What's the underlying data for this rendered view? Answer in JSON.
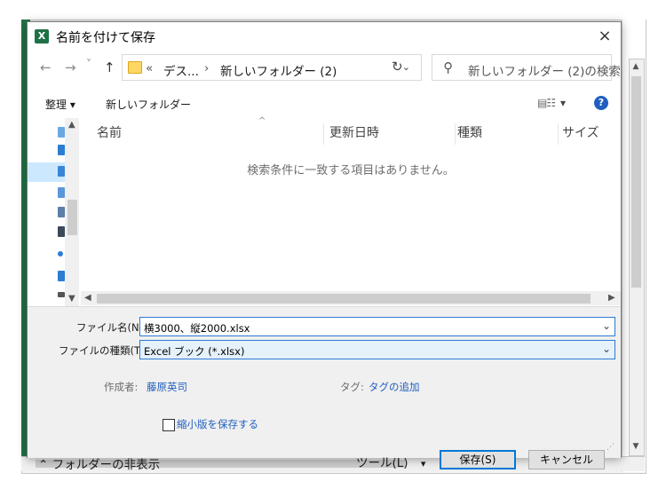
{
  "window": {
    "app_icon": "X",
    "title": "名前を付けて保存",
    "close": "×"
  },
  "nav": {
    "back": "←",
    "forward": "→",
    "recent": "˅",
    "up": "↑",
    "breadcrumb": {
      "overflow": "«",
      "parent": "デス...",
      "separator": "›",
      "current": "新しいフォルダー (2)"
    },
    "dropdown": "⌄",
    "refresh": "↻",
    "search_placeholder": "新しいフォルダー (2)の検索"
  },
  "toolbar": {
    "organize": "整理 ▾",
    "new_folder": "新しいフォルダー",
    "view_caret": "▾",
    "help": "?"
  },
  "file_list": {
    "columns": [
      "名前",
      "更新日時",
      "種類",
      "サイズ"
    ],
    "empty_message": "検索条件に一致する項目はありません。"
  },
  "form": {
    "filename_label": "ファイル名(N):",
    "filename_value": "横3000、縦2000.xlsx",
    "filetype_label": "ファイルの種類(T):",
    "filetype_value": "Excel ブック (*.xlsx)",
    "author_label": "作成者:",
    "author_value": "藤原英司",
    "tags_label": "タグ:",
    "tags_value": "タグの追加",
    "thumbnail_label": "縮小版を保存する"
  },
  "footer": {
    "hide_folders": "フォルダーの非表示",
    "tools": "ツール(L)",
    "save": "保存(S)",
    "cancel": "キャンセル"
  },
  "colors": {
    "accent": "#0078d7",
    "excel_green": "#217346",
    "link_blue": "#1f5fbf"
  }
}
